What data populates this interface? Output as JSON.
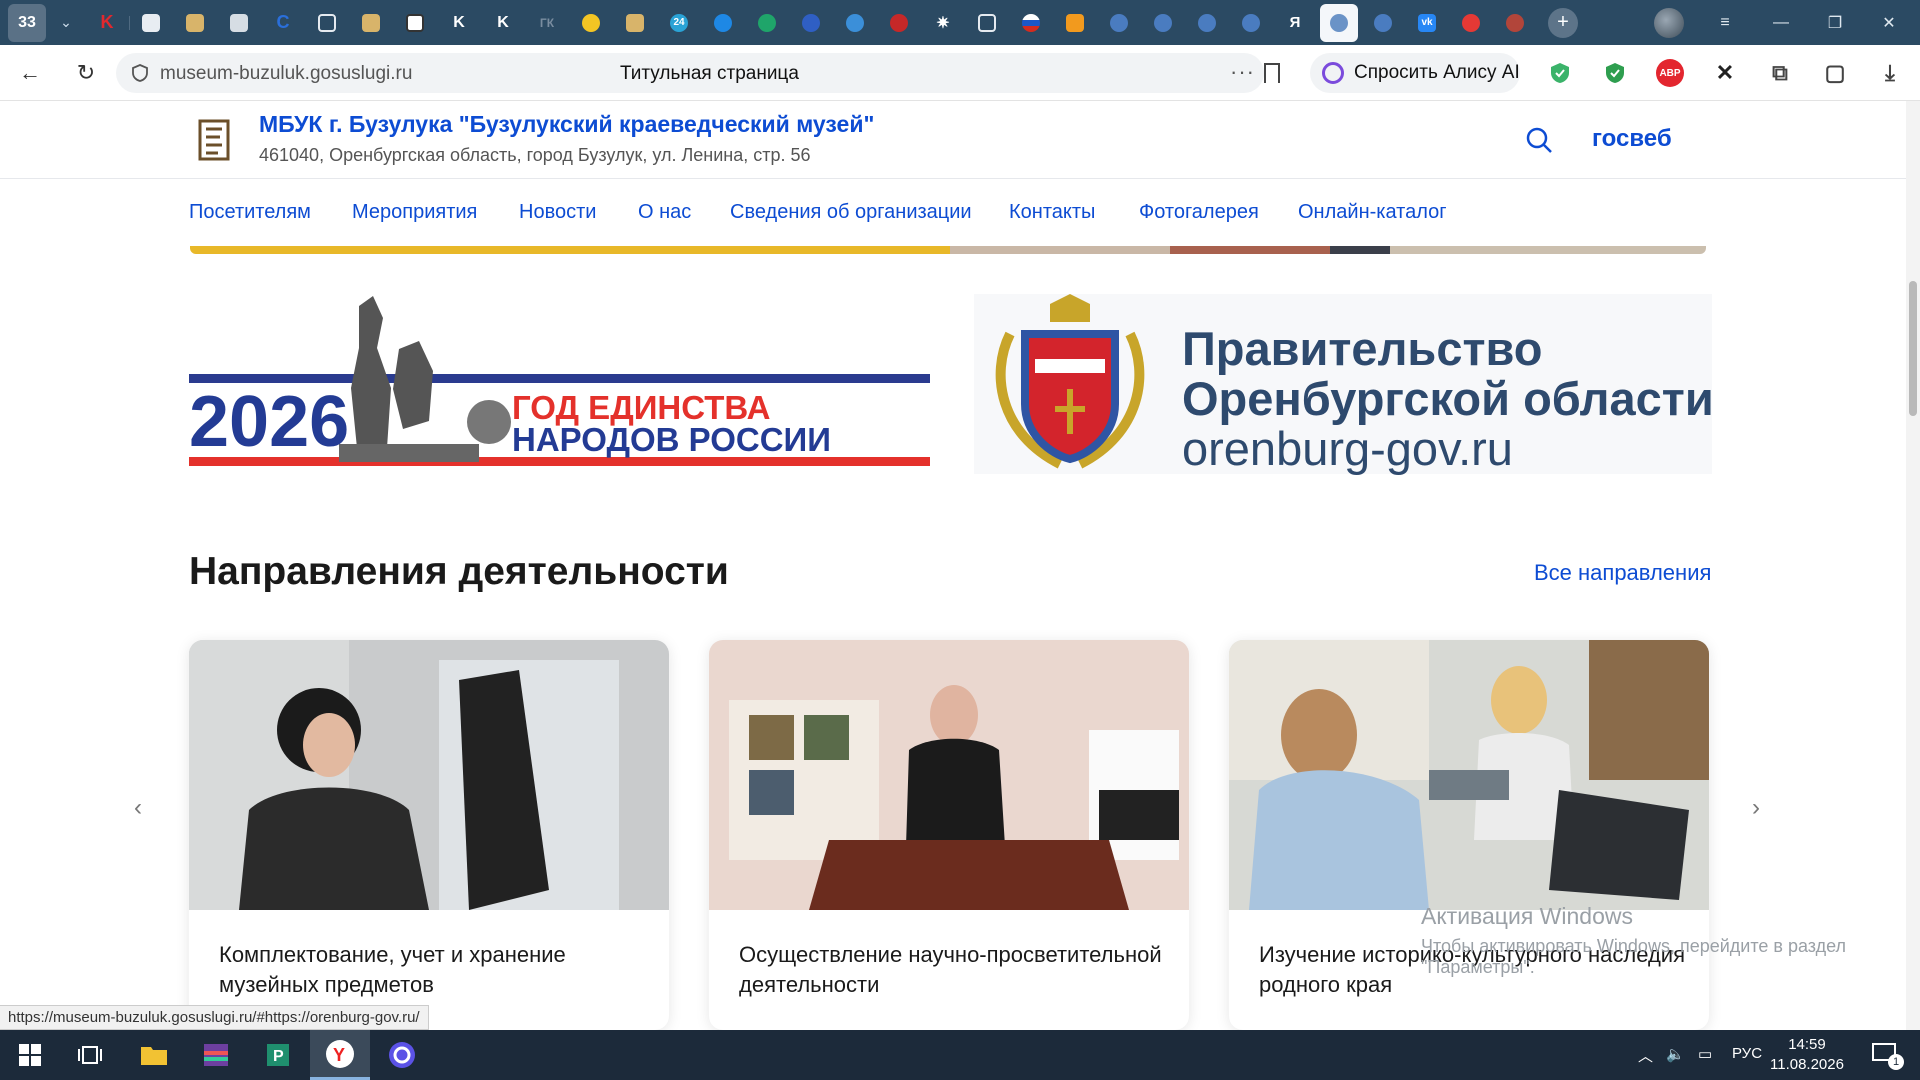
{
  "browser": {
    "tab_count": "33",
    "yandex_tab_letter": "Я",
    "page_title": "Титульная страница",
    "url": "museum-buzuluk.gosuslugi.ru",
    "more_label": "···",
    "alisa_label": "Спросить Алису AI",
    "abp_label": "ABP",
    "status_url": "https://museum-buzuluk.gosuslugi.ru/#https://orenburg-gov.ru/"
  },
  "site": {
    "name": "МБУК г. Бузулука \"Бузулукский краеведческий музей\"",
    "address": "461040, Оренбургская область, город Бузулук, ул. Ленина, стр. 56",
    "gosweb": "госвеб",
    "nav": [
      "Посетителям",
      "Мероприятия",
      "Новости",
      "О нас",
      "Сведения об организации",
      "Контакты",
      "Фотогалерея",
      "Онлайн-каталог"
    ]
  },
  "banners": {
    "unity_year": "2026",
    "unity_line1": "ГОД ЕДИНСТВА",
    "unity_line2": "НАРОДОВ РОССИИ",
    "gov_line1": "Правительство",
    "gov_line2": "Оренбургской области",
    "gov_url": "orenburg-gov.ru"
  },
  "section": {
    "title": "Направления деятельности",
    "all_link": "Все направления",
    "prev_arrow": "‹",
    "next_arrow": "›",
    "cards": [
      {
        "title": "Комплектование, учет и хранение музейных предметов"
      },
      {
        "title": "Осуществление научно-просветительной деятельности"
      },
      {
        "title": "Изучение историко-культурного наследия родного края"
      }
    ]
  },
  "windows": {
    "activation_title": "Активация Windows",
    "activation_text": "Чтобы активировать Windows, перейдите в раздел \"Параметры\".",
    "lang": "РУС",
    "time": "14:59",
    "date": "11.08.2026",
    "notification_count": "1"
  },
  "colors": {
    "accent": "#0d4cd3",
    "tabstrip": "#2b4a63",
    "taskbar": "#1c2a3a"
  }
}
